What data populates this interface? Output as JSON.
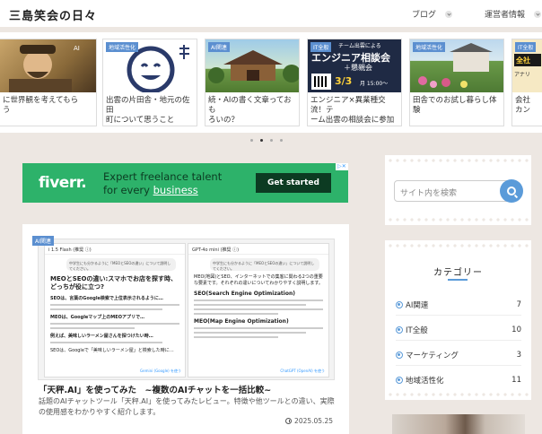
{
  "header": {
    "site_title": "三島笑会の日々",
    "nav": [
      {
        "label": "ブログ"
      },
      {
        "label": "運営者情報"
      }
    ]
  },
  "carousel": {
    "prev_icon": "chevron-left-icon",
    "next_icon": "chevron-right-icon",
    "cards": [
      {
        "tag": "",
        "title": "に世界観を考えてもら\nう"
      },
      {
        "tag": "地域活性化",
        "title": "出雲の片田舎・地元の佐田\n町について思うこと"
      },
      {
        "tag": "AI関連",
        "title": "続・AIの書く文章っておも\nろいの？"
      },
      {
        "tag": "IT全般",
        "title": "エンジニア×異業種交流！テ\nーム出雲の相談会に参加し\nました"
      },
      {
        "tag": "地域活性化",
        "title": "田舎でのお試し暮らし体験"
      },
      {
        "tag": "IT全般",
        "title": "会社\nカン"
      }
    ],
    "thumb_texts": {
      "card3_banner": "チーム出雲による",
      "card3_main": "エンジニア相談会",
      "card3_sub": "＋懇親会",
      "card3_date": "3/3",
      "card3_time": "月 15:00〜",
      "card5_tag": "全社",
      "card5_line": "アナリ",
      "card0_ai": "AI"
    },
    "dots": 4,
    "active_dot": 1
  },
  "ad": {
    "brand": "fiverr",
    "line1": "Expert freelance talent",
    "line2_prefix": "for every ",
    "line2_link": "business",
    "cta": "Get started",
    "badge": "▷✕"
  },
  "post": {
    "tag": "AI関連",
    "left_pane": {
      "header": "i 1.5 Flash (推奨 ⓘ)",
      "prompt": "中学生にも分かるように「MEOとSEOの違い」について説明してください。",
      "heading": "MEOとSEOの違い:スマホでお店を探す時、どっちが役に立つ?",
      "sub1": "SEOは、言葉のGoogle検索で上位表示されるように…",
      "sub2": "MEOは、Googleマップ上のMEOアプリで…",
      "sub3": "例えば、美味しいラーメン屋さんを探つけたい時…",
      "bullet": "SEOは、Googleで「美味しいラーメン屋」と検索した時に…",
      "footer": "Gemini (Google) を使う"
    },
    "right_pane": {
      "header": "GPT-4o mini (推奨 ⓘ)",
      "prompt": "中学生にも分かるように「MEOとSEOの違い」について説明してください。",
      "intro": "MEO(地図)とSEO、インターネットでの集客に関わる2つの重要な要素です。それぞれの違いについてわかりやすく説明します。",
      "sub1": "SEO(Search Engine Optimization)",
      "sub2": "MEO(Map Engine Optimization)",
      "footer": "ChatGPT (OpenAI) を使う"
    },
    "title": "「天秤.AI」を使ってみた　~複数のAIチャットを一括比較~",
    "excerpt": "話題のAIチャットツール「天秤.AI」を使ってみたレビュー。特徴や他ツールとの違い、実際の使用感をわかりやすく紹介します。",
    "date": "2025.05.25"
  },
  "sidebar": {
    "search_placeholder": "サイト内を検索",
    "categories_title": "カテゴリー",
    "categories": [
      {
        "name": "AI関連",
        "count": "7"
      },
      {
        "name": "IT全般",
        "count": "10"
      },
      {
        "name": "マーケティング",
        "count": "3"
      },
      {
        "name": "地域活性化",
        "count": "11"
      }
    ]
  },
  "colors": {
    "accent": "#5b9bd9",
    "tag": "#5b8fd0",
    "ad_green": "#2db26a",
    "background": "#ede7e2"
  }
}
